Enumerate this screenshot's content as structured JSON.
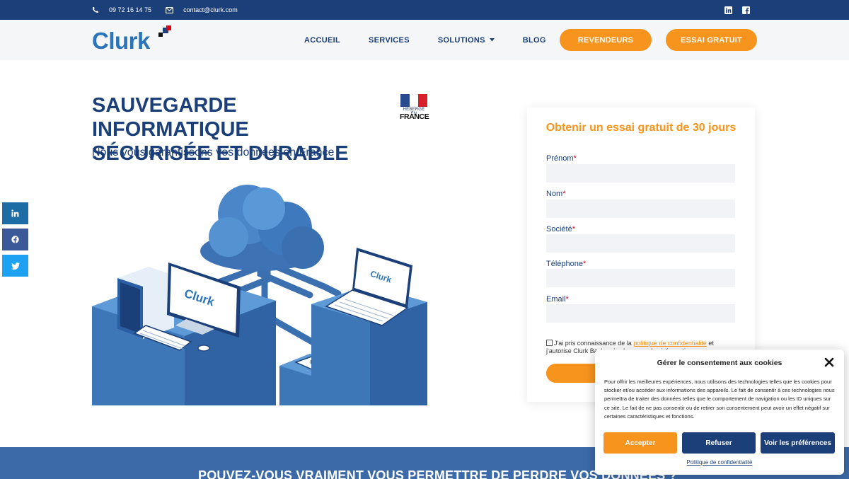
{
  "topbar": {
    "phone": "09 72 16 14 75",
    "email": "contact@clurk.com"
  },
  "header": {
    "logo_text": "Clurk",
    "nav": {
      "accueil": "ACCUEIL",
      "services": "SERVICES",
      "solutions": "SOLUTIONS",
      "blog": "BLOG"
    },
    "revendeurs": "REVENDEURS",
    "essai": "ESSAI GRATUIT"
  },
  "hero": {
    "title_line1": "SAUVEGARDE INFORMATIQUE",
    "title_line2": "SÉCURISÉE ET DURABLE",
    "subtitle": "Nous vous garantissons vos données en France",
    "badge_top": "HÉBERGÉ EN",
    "badge_bottom": "FRANCE",
    "screen_brand": "Clurk"
  },
  "form": {
    "title": "Obtenir un essai gratuit de 30 jours",
    "fields": [
      {
        "label": "Prénom",
        "value": ""
      },
      {
        "label": "Nom",
        "value": ""
      },
      {
        "label": "Société",
        "value": ""
      },
      {
        "label": "Téléphone",
        "value": ""
      },
      {
        "label": "Email",
        "value": ""
      }
    ],
    "required_mark": "*",
    "consent_prefix": "J'ai pris connaissance de la ",
    "consent_link": "politique de confidentialité",
    "consent_suffix": " et",
    "consent_line2": "j'autorise Clurk Backup à m'envoyer des informations"
  },
  "band": {
    "text": "POUVEZ-VOUS VRAIMENT VOUS PERMETTRE DE PERDRE VOS DONNÉES ?"
  },
  "cookie": {
    "title": "Gérer le consentement aux cookies",
    "body": "Pour offrir les meilleures expériences, nous utilisons des technologies telles que les cookies pour stocker et/ou accéder aux informations des appareils. Le fait de consentir à ces technologies nous permettra de traiter des données telles que le comportement de navigation ou les ID uniques sur ce site. Le fait de ne pas consentir ou de retirer son consentement peut avoir un effet négatif sur certaines caractéristiques et fonctions.",
    "accept": "Accepter",
    "refuse": "Refuser",
    "prefs": "Voir les préférences",
    "policy_link": "Politique de confidentialité"
  },
  "colors": {
    "navy": "#1b3f78",
    "orange": "#f7941d",
    "band_blue": "#3c6aa8",
    "linkedin": "#1c6ca5",
    "facebook": "#3b5998",
    "twitter": "#1da1f2"
  }
}
